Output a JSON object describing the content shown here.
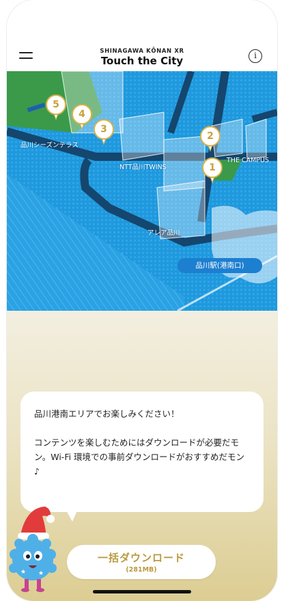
{
  "header": {
    "brand_sub": "SHINAGAWA KŌNAN XR",
    "brand_title": "Touch the City",
    "menu_icon": "hamburger-menu-icon",
    "info_icon": "info-icon",
    "info_glyph": "i"
  },
  "map": {
    "labels": {
      "seasons_terrace": "品川シーズンテラス",
      "ntt_twins": "NTT品川TWINS",
      "the_campus": "THE CAMPUS",
      "area_shinagawa": "アレア品川"
    },
    "station": "品川駅(港南口)",
    "pins": [
      {
        "number": "1"
      },
      {
        "number": "2"
      },
      {
        "number": "3"
      },
      {
        "number": "4"
      },
      {
        "number": "5"
      }
    ],
    "colors": {
      "water": "#1e9ae0",
      "road": "#15466e",
      "park": "#3a9a4a",
      "pin": "#d8b24a"
    }
  },
  "message": {
    "line1": "品川港南エリアでお楽しみください！",
    "line2": "コンテンツを楽しむためにはダウンロードが必要だモン。Wi-Fi 環境での事前ダウンロードがおすすめだモン♪"
  },
  "download": {
    "label": "一括ダウンロード",
    "size": "(281MB)"
  },
  "mascot": {
    "icon": "mascot-character-icon"
  }
}
